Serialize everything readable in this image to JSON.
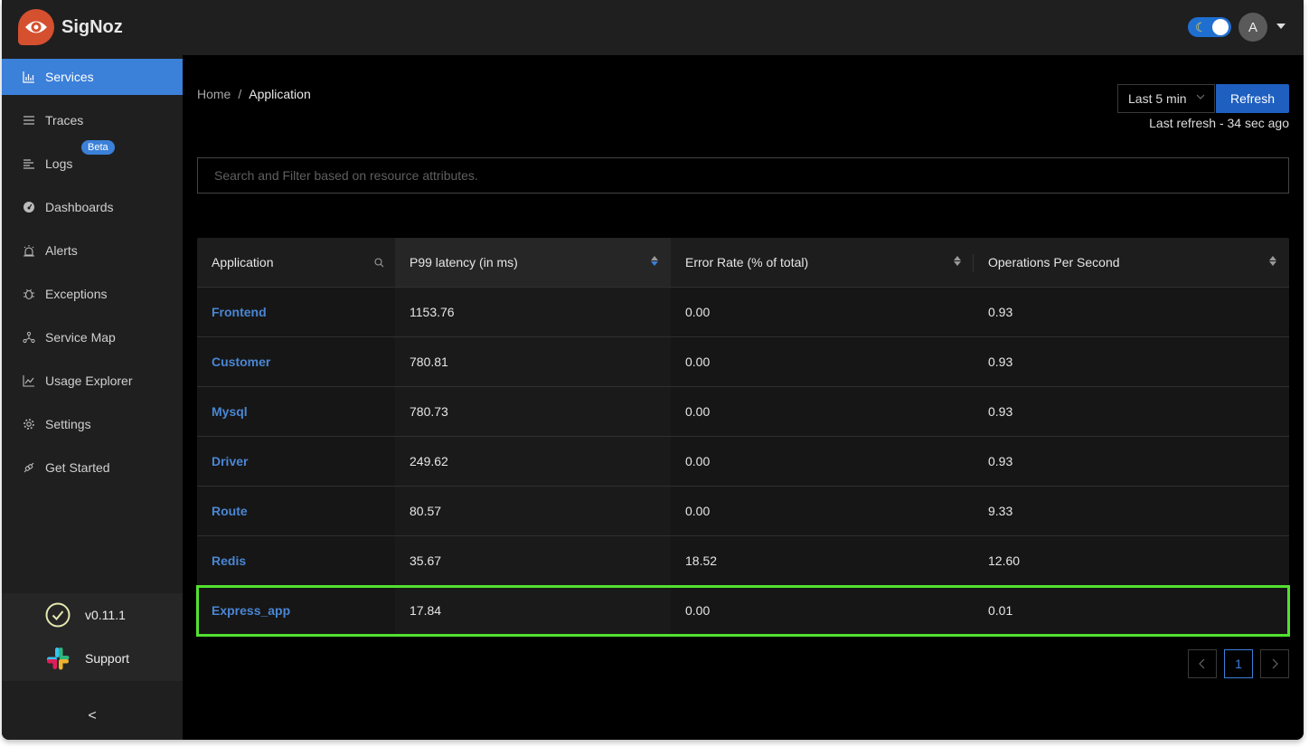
{
  "app": {
    "name": "SigNoz",
    "user_initial": "A",
    "theme_toggle": "dark",
    "colors": {
      "accent": "#3b80d9",
      "brand": "#d4502f",
      "highlight": "#52e12f",
      "link": "#4a86d4"
    }
  },
  "sidebar": {
    "items": [
      {
        "label": "Services",
        "icon": "bar-chart-icon",
        "active": true
      },
      {
        "label": "Traces",
        "icon": "menu-icon"
      },
      {
        "label": "Logs",
        "icon": "align-left-icon",
        "badge": "Beta"
      },
      {
        "label": "Dashboards",
        "icon": "dashboard-icon"
      },
      {
        "label": "Alerts",
        "icon": "alert-icon"
      },
      {
        "label": "Exceptions",
        "icon": "bug-icon"
      },
      {
        "label": "Service Map",
        "icon": "deployment-unit-icon"
      },
      {
        "label": "Usage Explorer",
        "icon": "line-chart-icon"
      },
      {
        "label": "Settings",
        "icon": "gear-icon"
      },
      {
        "label": "Get Started",
        "icon": "api-icon"
      }
    ],
    "version": "v0.11.1",
    "support": "Support",
    "collapse": "<"
  },
  "header": {
    "breadcrumb": {
      "home": "Home",
      "separator": "/",
      "current": "Application"
    },
    "time_range": "Last 5 min",
    "refresh_label": "Refresh",
    "last_refresh": "Last refresh - 34 sec ago"
  },
  "search": {
    "placeholder": "Search and Filter based on resource attributes.",
    "value": ""
  },
  "table": {
    "columns": [
      "Application",
      "P99 latency (in ms)",
      "Error Rate (% of total)",
      "Operations Per Second"
    ],
    "sorted_column": "P99 latency (in ms)",
    "sort_direction": "descending",
    "rows": [
      {
        "application": "Frontend",
        "p99": "1153.76",
        "error_rate": "0.00",
        "ops": "0.93"
      },
      {
        "application": "Customer",
        "p99": "780.81",
        "error_rate": "0.00",
        "ops": "0.93"
      },
      {
        "application": "Mysql",
        "p99": "780.73",
        "error_rate": "0.00",
        "ops": "0.93"
      },
      {
        "application": "Driver",
        "p99": "249.62",
        "error_rate": "0.00",
        "ops": "0.93"
      },
      {
        "application": "Route",
        "p99": "80.57",
        "error_rate": "0.00",
        "ops": "9.33"
      },
      {
        "application": "Redis",
        "p99": "35.67",
        "error_rate": "18.52",
        "ops": "12.60"
      },
      {
        "application": "Express_app",
        "p99": "17.84",
        "error_rate": "0.00",
        "ops": "0.01",
        "highlighted": true
      }
    ]
  },
  "pagination": {
    "prev": "<",
    "current_page": "1",
    "next": ">"
  }
}
